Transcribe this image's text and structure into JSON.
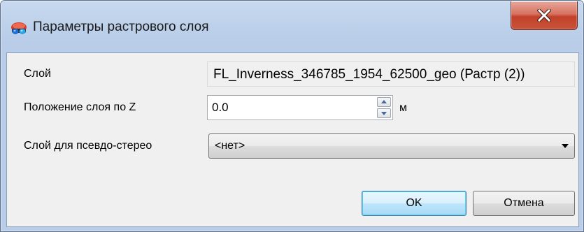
{
  "window": {
    "title": "Параметры растрового слоя",
    "icon": "stereo-glasses-icon",
    "close_icon": "close-icon"
  },
  "form": {
    "layer": {
      "label": "Слой",
      "value": "FL_Inverness_346785_1954_62500_geo (Растр (2))"
    },
    "z_position": {
      "label": "Положение слоя по Z",
      "value": "0.0",
      "unit": "м"
    },
    "pseudo_stereo": {
      "label": "Слой для псевдо-стерео",
      "selected": "<нет>"
    }
  },
  "buttons": {
    "ok": "OK",
    "cancel": "Отмена"
  },
  "colors": {
    "frame": "#b9cde8",
    "client": "#f0f0f0",
    "close_button": "#c9543b",
    "default_button_border": "#3c7fb1"
  }
}
